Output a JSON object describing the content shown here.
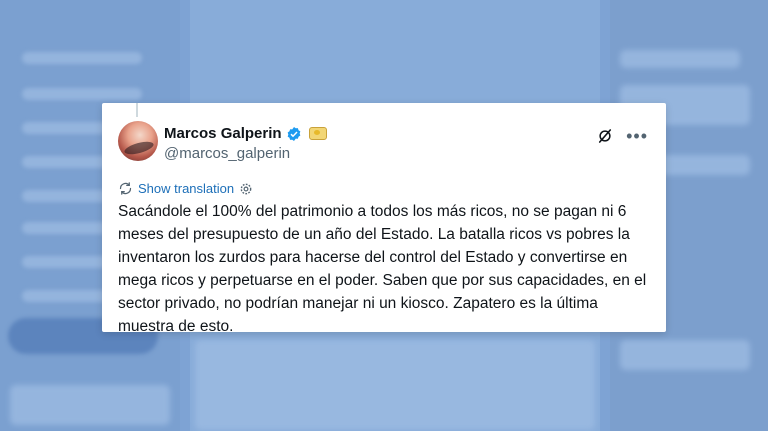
{
  "tweet": {
    "author_name": "Marcos Galperin",
    "handle": "@marcos_galperin",
    "translate_label": "Show translation",
    "text": "Sacándole el 100% del patrimonio a todos los más ricos, no se pagan ni 6 meses del presupuesto de un año del Estado. La batalla ricos vs pobres la inventaron los zurdos para hacerse del control del Estado y convertirse en mega ricos y perpetuarse en el poder. Saben que por sus capacidades, en el sector privado, no podrían manejar ni un kiosco. Zapatero es la última muestra de esto."
  },
  "colors": {
    "verified": "#1d9bf0",
    "link": "#1d6fb8",
    "background_overlay": "#7ea3d4"
  },
  "icons": {
    "verified": "verified-badge-icon",
    "affiliate": "affiliate-badge-icon",
    "grok": "grok-icon",
    "more": "more-icon",
    "translate": "translate-icon",
    "settings": "gear-icon"
  }
}
